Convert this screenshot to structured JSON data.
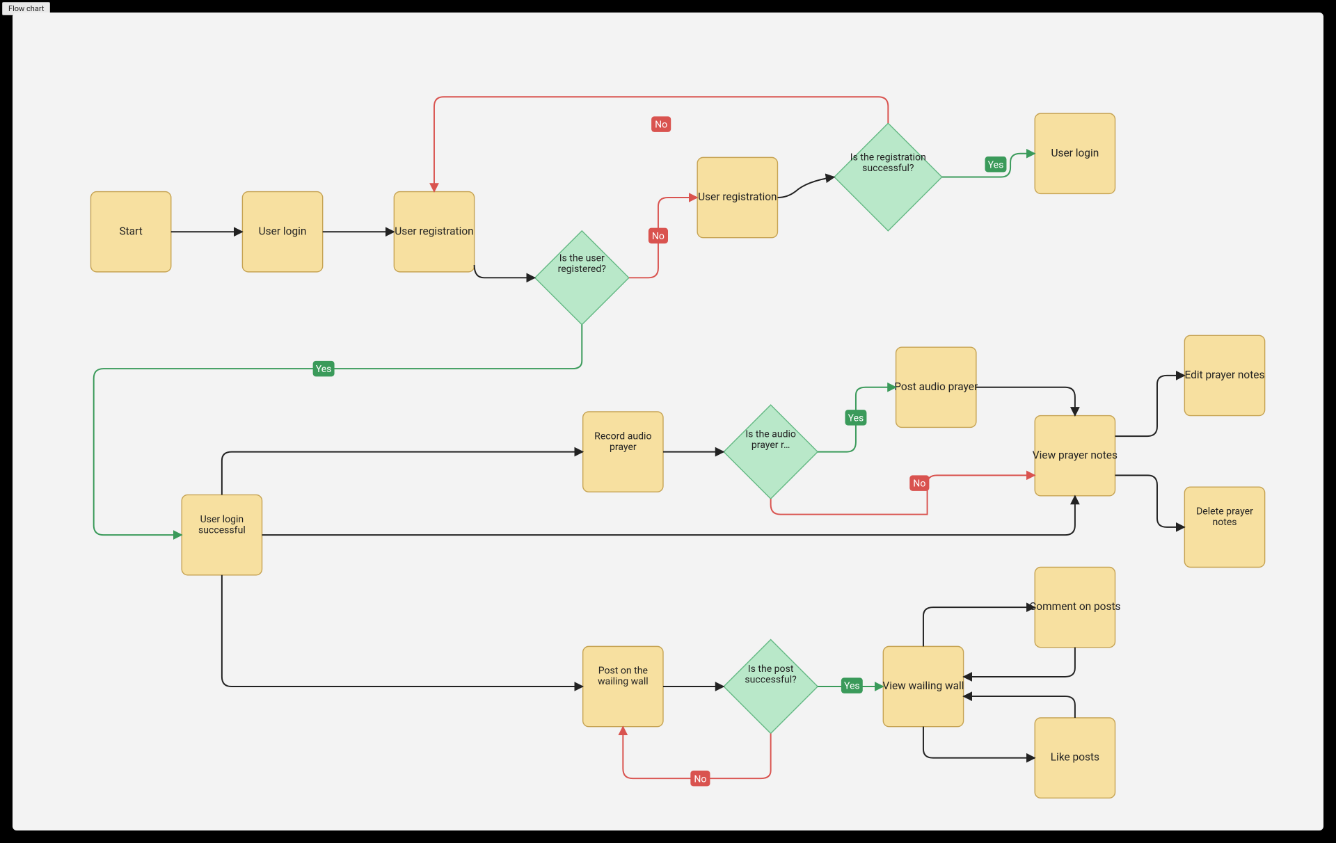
{
  "tab_label": "Flow chart",
  "nodes": {
    "start": "Start",
    "user_login1": "User login",
    "user_registration1": "User registration",
    "is_user_registered": "Is the user registered?",
    "user_registration2": "User registration",
    "is_registration_successful": "Is the registration successful?",
    "user_login2": "User login",
    "user_login_successful": "User login successful",
    "record_audio_prayer": "Record audio prayer",
    "is_audio_prayer_r": "Is the audio prayer r…",
    "post_audio_prayer": "Post audio prayer",
    "view_prayer_notes": "View prayer notes",
    "edit_prayer_notes": "Edit prayer notes",
    "delete_prayer_notes": "Delete prayer notes",
    "post_on_wailing_wall": "Post on the wailing wall",
    "is_post_successful": "Is the post successful?",
    "view_wailing_wall": "View wailing wall",
    "comment_on_posts": "Comment on posts",
    "like_posts": "Like posts"
  },
  "badges": {
    "yes": "Yes",
    "no": "No"
  }
}
